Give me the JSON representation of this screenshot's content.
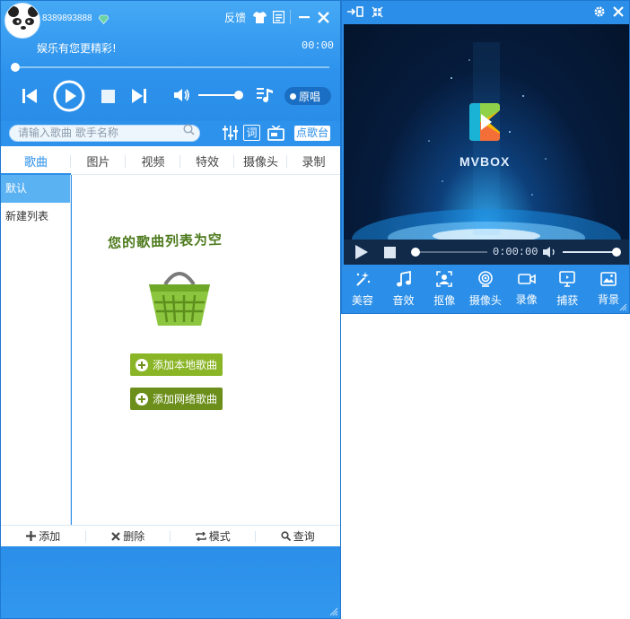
{
  "player": {
    "user_id": "8389893888",
    "feedback": "反馈",
    "slogan": "娱乐有您更精彩!",
    "time": "00:00",
    "original_vocal": "原唱"
  },
  "search": {
    "placeholder": "请输入歌曲 歌手名称",
    "lyrics_button": "词",
    "song_request_button": "点歌台"
  },
  "tabs": [
    {
      "label": "歌曲",
      "active": true
    },
    {
      "label": "图片"
    },
    {
      "label": "视频"
    },
    {
      "label": "特效"
    },
    {
      "label": "摄像头"
    },
    {
      "label": "录制"
    }
  ],
  "sidebar": {
    "items": [
      {
        "label": "默认",
        "active": true
      },
      {
        "label": "新建列表"
      }
    ]
  },
  "playlist": {
    "empty_text": "您的歌曲列表为空",
    "add_local": "添加本地歌曲",
    "add_online": "添加网络歌曲"
  },
  "bottom_bar": {
    "add": "添加",
    "delete": "删除",
    "mode": "模式",
    "search": "查询"
  },
  "mvbox": {
    "logo_text": "MVBOX",
    "time": "0:00:00",
    "tools": [
      "美容",
      "音效",
      "抠像",
      "摄像头",
      "录像",
      "捕获",
      "背景"
    ]
  },
  "colors": {
    "primary": "#2b8fe9",
    "accent_green": "#8ab526",
    "accent_green_dark": "#6b8f1a"
  }
}
